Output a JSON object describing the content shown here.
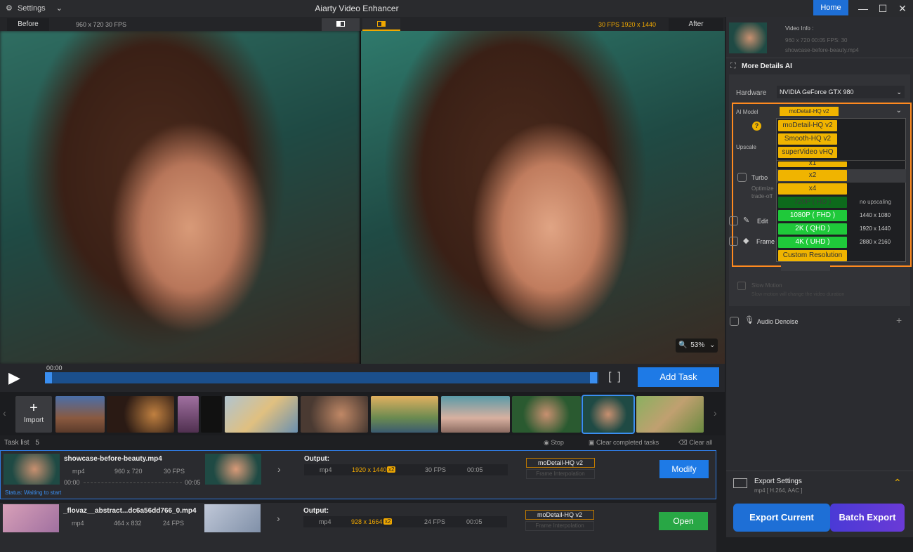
{
  "titlebar": {
    "settings_label": "Settings",
    "app_title": "Aiarty Video Enhancer",
    "home_label": "Home",
    "minimize": "—",
    "maximize": "☐",
    "close": "✕"
  },
  "preview": {
    "before_label": "Before",
    "before_info": "960 x 720  30 FPS",
    "after_info": "30 FPS   1920 x 1440",
    "after_label": "After",
    "zoom_level": "53%"
  },
  "timeline": {
    "time": "00:00",
    "add_task_label": "Add Task"
  },
  "thumbs": {
    "import_label": "Import"
  },
  "tasklist": {
    "header": "Task list",
    "count": "5",
    "stop_label": "Stop",
    "clear_completed_label": "Clear completed tasks",
    "clear_all_label": "Clear all",
    "tasks": [
      {
        "name": "showcase-before-beauty.mp4",
        "format": "mp4",
        "resolution": "960 x 720",
        "fps": "30 FPS",
        "time_start": "00:00",
        "time_end": "00:05",
        "status": "Status: Waiting to start",
        "output_label": "Output:",
        "out_format": "mp4",
        "out_resolution": "1920 x 1440",
        "out_scale": "x2",
        "out_fps": "30 FPS",
        "out_duration": "00:05",
        "model": "moDetail-HQ  v2",
        "interp": "Frame Interpolation",
        "action": "Modify"
      },
      {
        "name": "_flovaz__abstract...dc6a56dd766_0.mp4",
        "format": "mp4",
        "resolution": "464 x 832",
        "fps": "24 FPS",
        "output_label": "Output:",
        "out_format": "mp4",
        "out_resolution": "928 x 1664",
        "out_scale": "x2",
        "out_fps": "24 FPS",
        "out_duration": "00:05",
        "model": "moDetail-HQ  v2",
        "interp": "Frame Interpolation",
        "action": "Open"
      }
    ]
  },
  "panel": {
    "video_info_label": "Video Info :",
    "video_info_details": "960 x 720  00:05   FPS: 30",
    "video_info_file": "showcase-before-beauty.mp4",
    "section_title": "More Details AI",
    "hardware_label": "Hardware",
    "hardware_value": "NVIDIA GeForce GTX 980",
    "ai_model_label": "AI Model",
    "ai_model_value": "moDetail-HQ  v2",
    "upscale_label": "Upscale",
    "turbo_label": "Turbo",
    "turbo_desc_1": "Optimize",
    "turbo_desc_2": "trade-off",
    "edit_label": "Edit",
    "frame_label": "Frame I",
    "models": [
      "moDetail-HQ  v2",
      "Smooth-HQ  v2",
      "superVideo vHQ"
    ],
    "scales": [
      "x1",
      "x2",
      "x4"
    ],
    "resolutions": [
      {
        "label": "720P  ( HD )",
        "value": "no upscaling"
      },
      {
        "label": "1080P  ( FHD )",
        "value": "1440 x 1080"
      },
      {
        "label": "2K  ( QHD )",
        "value": "1920 x 1440"
      },
      {
        "label": "4K  ( UHD )",
        "value": "2880 x 2160"
      }
    ],
    "custom_resolution": "Custom Resolution",
    "slow_motion_label": "Slow Motion",
    "slow_motion_desc": "Slow motion will change the video duration",
    "audio_denoise_label": "Audio Denoise",
    "export_settings_label": "Export Settings",
    "export_settings_value": "mp4 [ H.264, AAC ]",
    "export_current_label": "Export Current",
    "batch_export_label": "Batch Export"
  },
  "colors": {
    "accent_blue": "#1e6fd6",
    "highlight_orange": "#ff8a1f",
    "model_yellow": "#f0b400",
    "res_green": "#1fc93a",
    "open_green": "#28a745"
  }
}
